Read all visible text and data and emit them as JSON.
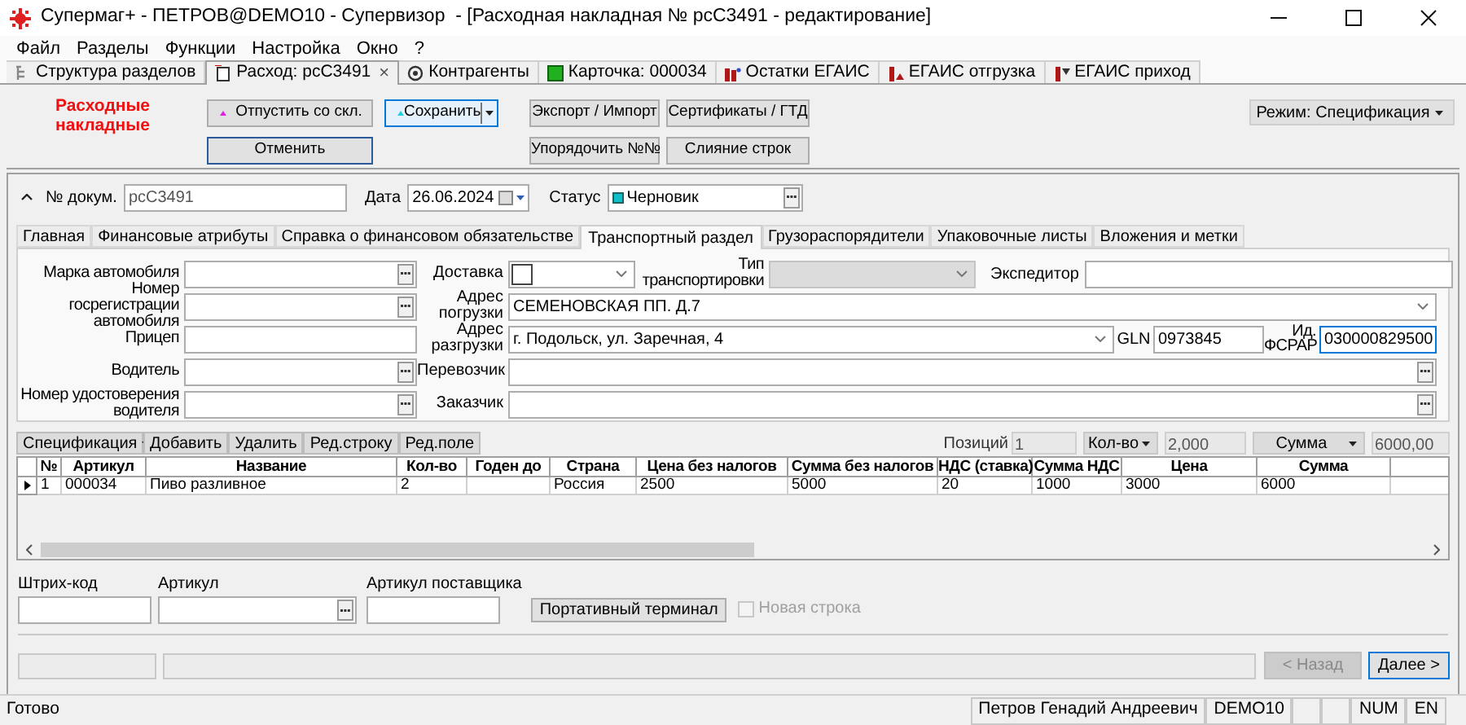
{
  "window": {
    "title": "Супермаг+ - ПЕТРОВ@DEMO10 - Супервизор  - [Расходная накладная № рсС3491 - редактирование]"
  },
  "menu": [
    "Файл",
    "Разделы",
    "Функции",
    "Настройка",
    "Окно",
    "?"
  ],
  "doc_tabs": [
    {
      "label": "Структура разделов",
      "selected": false
    },
    {
      "label": "Расход: рсС3491",
      "selected": true,
      "close": "×"
    },
    {
      "label": "Контрагенты",
      "selected": false
    },
    {
      "label": "Карточка: 000034",
      "selected": false
    },
    {
      "label": "Остатки ЕГАИС",
      "selected": false
    },
    {
      "label": "ЕГАИС отгрузка",
      "selected": false
    },
    {
      "label": "ЕГАИС приход",
      "selected": false
    }
  ],
  "toolbar": {
    "title": "Расходные накладные",
    "columns": [
      [
        {
          "label": "Отпустить со скл.",
          "kind": "plain",
          "focused": false,
          "color": "#e020e0"
        },
        {
          "label": "Отменить",
          "kind": "default",
          "focused": false
        }
      ],
      [
        {
          "label": "Сохранить",
          "kind": "split",
          "focused": true,
          "color": "#20d0e0"
        }
      ],
      [
        {
          "label": "Экспорт / Импорт",
          "kind": "plain",
          "focused": false
        },
        {
          "label": "Упорядочить №№",
          "kind": "plain",
          "focused": false
        }
      ],
      [
        {
          "label": "Сертификаты / ГТД",
          "kind": "plain",
          "focused": false
        },
        {
          "label": "Слияние строк",
          "kind": "plain",
          "focused": false
        }
      ]
    ],
    "mode": {
      "label": "Режим: Спецификация"
    }
  },
  "header": {
    "doc_number": {
      "label": "№ докум.",
      "value": "рсС3491"
    },
    "date": {
      "label": "Дата",
      "value": "26.06.2024"
    },
    "status": {
      "label": "Статус",
      "value": "Черновик"
    }
  },
  "section_tabs": [
    {
      "label": "Главная",
      "selected": false
    },
    {
      "label": "Финансовые атрибуты",
      "selected": false
    },
    {
      "label": "Справка о финансовом обязательстве",
      "selected": false
    },
    {
      "label": "Транспортный раздел",
      "selected": true
    },
    {
      "label": "Грузораспорядители",
      "selected": false
    },
    {
      "label": "Упаковочные листы",
      "selected": false
    },
    {
      "label": "Вложения и метки",
      "selected": false
    }
  ],
  "transport": {
    "left": [
      {
        "label": "Марка автомобиля",
        "kind": "lookup"
      },
      {
        "label": "Номер госрегистрации автомобиля",
        "kind": "lookup"
      },
      {
        "label": "Прицеп",
        "kind": "text"
      },
      {
        "label": "Водитель",
        "kind": "lookup"
      },
      {
        "label": "Номер удостоверения водителя",
        "kind": "lookup"
      }
    ],
    "delivery": {
      "label": "Доставка"
    },
    "transport_type": {
      "label": "Тип транспортировки",
      "disabled": true
    },
    "forwarder": {
      "label": "Экспедитор"
    },
    "loading_address": {
      "label": "Адрес погрузки",
      "value": "СЕМЕНОВСКАЯ ПП. Д.7"
    },
    "unloading_address": {
      "label": "Адрес разгрузки",
      "value": "г. Подольск, ул. Заречная, 4"
    },
    "gln": {
      "label": "GLN",
      "value": "0973845"
    },
    "fsrar": {
      "label": "Ид. ФСРАР",
      "value": "030000829500"
    },
    "carrier": {
      "label": "Перевозчик"
    },
    "customer": {
      "label": "Заказчик"
    }
  },
  "spec_toolbar": {
    "buttons": [
      {
        "label": "Спецификация",
        "kind": "dropdown"
      },
      {
        "label": "Добавить",
        "kind": "plain"
      },
      {
        "label": "Удалить",
        "kind": "plain"
      },
      {
        "label": "Ред.строку",
        "kind": "plain"
      },
      {
        "label": "Ред.поле",
        "kind": "plain"
      }
    ],
    "positions": {
      "label": "Позиций",
      "value": "1"
    },
    "quantity": {
      "label": "Кол-во",
      "value": "2,000"
    },
    "sum": {
      "label": "Сумма",
      "value": "6000,00"
    }
  },
  "table": {
    "columns": [
      "№",
      "Артикул",
      "Название",
      "Кол-во",
      "Годен до",
      "Страна",
      "Цена без налогов",
      "Сумма без налогов",
      "НДС (ставка)",
      "Сумма НДС",
      "Цена",
      "Сумма"
    ],
    "rows": [
      {
        "selected": true,
        "cells": [
          "1",
          "000034",
          "Пиво разливное",
          "2",
          "",
          "Россия",
          "2500",
          "5000",
          "20",
          "1000",
          "3000",
          "6000"
        ]
      }
    ]
  },
  "entry": {
    "barcode": {
      "label": "Штрих-код"
    },
    "article": {
      "label": "Артикул"
    },
    "supplier_article": {
      "label": "Артикул поставщика"
    },
    "terminal_button": {
      "label": "Портативный терминал"
    },
    "new_row": {
      "label": "Новая строка",
      "checked": false,
      "disabled": true
    }
  },
  "nav": [
    {
      "label": "< Назад",
      "disabled": true
    },
    {
      "label": "Далее >",
      "disabled": false
    }
  ],
  "status_bar": {
    "text": "Готово",
    "panels": [
      "Петров Генадий Андреевич",
      "DEMO10",
      "NUM",
      "EN"
    ]
  }
}
